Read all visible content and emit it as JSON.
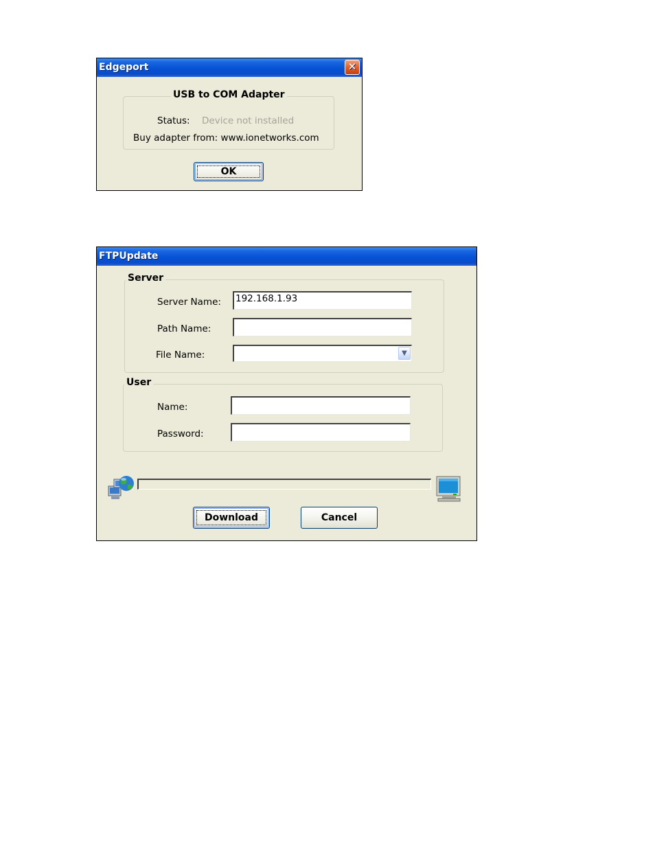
{
  "edgeport": {
    "title": "Edgeport",
    "group_title": "USB to COM Adapter",
    "status_label": "Status:",
    "status_value": "Device not installed",
    "buy_label": "Buy adapter from: www.ionetworks.com",
    "ok_label": "OK"
  },
  "ftpupdate": {
    "title": "FTPUpdate",
    "server": {
      "caption": "Server",
      "server_name_label": "Server Name:",
      "server_name_value": "192.168.1.93",
      "path_name_label": "Path Name:",
      "path_name_value": "",
      "file_name_label": "File Name:",
      "file_name_value": ""
    },
    "user": {
      "caption": "User",
      "name_label": "Name:",
      "name_value": "",
      "password_label": "Password:",
      "password_value": ""
    },
    "progress": 0,
    "download_label": "Download",
    "cancel_label": "Cancel"
  },
  "icons": {
    "close": "close-icon",
    "network": "network-globe-icon",
    "computer": "computer-monitor-icon",
    "dropdown": "chevron-down-icon"
  }
}
